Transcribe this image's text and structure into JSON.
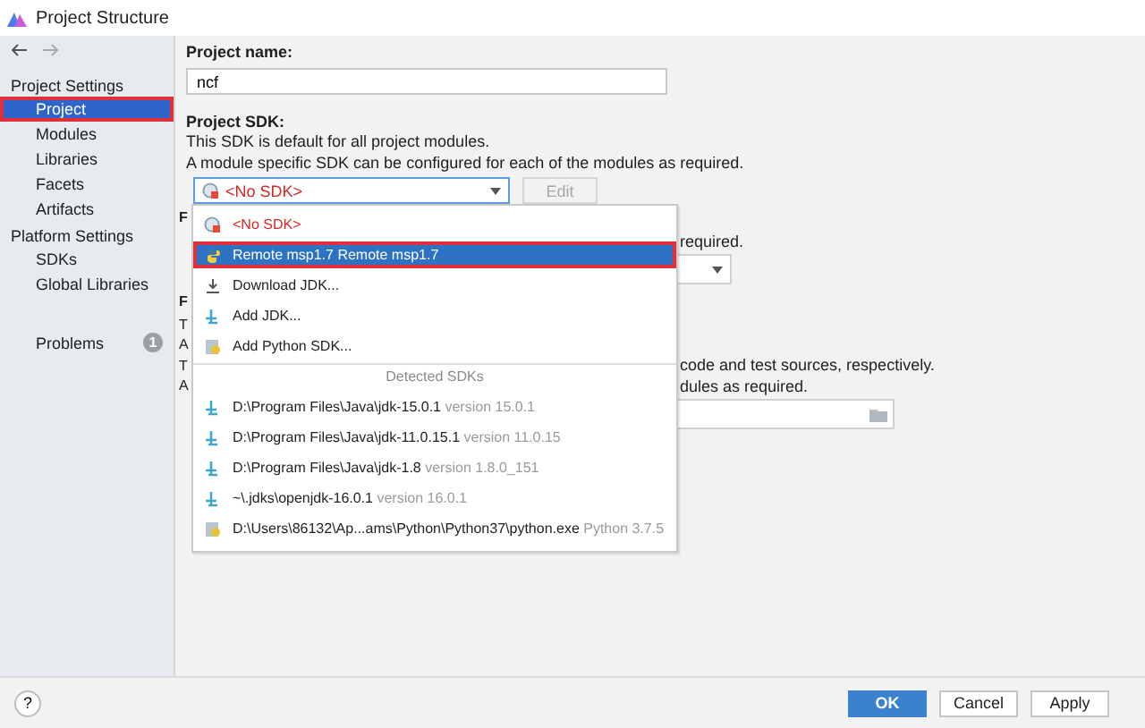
{
  "window": {
    "title": "Project Structure"
  },
  "sidebar": {
    "sections": [
      {
        "heading": "Project Settings",
        "items": [
          {
            "label": "Project",
            "selected": true,
            "outlined": true
          },
          {
            "label": "Modules",
            "selected": false,
            "outlined": false
          },
          {
            "label": "Libraries",
            "selected": false,
            "outlined": false
          },
          {
            "label": "Facets",
            "selected": false,
            "outlined": false
          },
          {
            "label": "Artifacts",
            "selected": false,
            "outlined": false
          }
        ]
      },
      {
        "heading": "Platform Settings",
        "items": [
          {
            "label": "SDKs",
            "selected": false,
            "outlined": false
          },
          {
            "label": "Global Libraries",
            "selected": false,
            "outlined": false
          }
        ]
      }
    ],
    "problems": {
      "label": "Problems",
      "count": "1"
    }
  },
  "project_name": {
    "label": "Project name:",
    "value": "ncf"
  },
  "project_sdk": {
    "label": "Project SDK:",
    "description": [
      "This SDK is default for all project modules.",
      "A module specific SDK can be configured for each of the modules as required."
    ],
    "combo": {
      "value": "<No SDK>"
    },
    "edit_button": {
      "label": "Edit",
      "disabled": true
    }
  },
  "background_rows": [
    {
      "kind": "heading",
      "left": "F"
    },
    {
      "kind": "text",
      "right": "required."
    },
    {
      "kind": "combo"
    },
    {
      "kind": "heading",
      "left": "F"
    },
    {
      "kind": "text",
      "left": "T"
    },
    {
      "kind": "text",
      "left": "A"
    },
    {
      "kind": "text",
      "left": "T",
      "right": "code and test sources, respectively."
    },
    {
      "kind": "text",
      "left": "A",
      "right": "dules as required."
    },
    {
      "kind": "field"
    }
  ],
  "sdk_popup": {
    "items": [
      {
        "kind": "no-sdk",
        "label": "<No SDK>",
        "error": true,
        "selected": false,
        "outlined": false
      },
      {
        "kind": "python",
        "label": "Remote msp1.7 Remote msp1.7",
        "error": false,
        "selected": true,
        "outlined": true
      },
      {
        "kind": "download",
        "label": "Download JDK...",
        "error": false,
        "selected": false,
        "outlined": false
      },
      {
        "kind": "jdk",
        "label": "Add JDK...",
        "error": false,
        "selected": false,
        "outlined": false
      },
      {
        "kind": "python-sdk",
        "label": "Add Python SDK...",
        "error": false,
        "selected": false,
        "outlined": false
      },
      {
        "kind": "separator",
        "label": "Detected SDKs"
      },
      {
        "kind": "jdk",
        "label": "D:\\Program Files\\Java\\jdk-15.0.1",
        "detail": "version 15.0.1",
        "error": false,
        "selected": false,
        "outlined": false
      },
      {
        "kind": "jdk",
        "label": "D:\\Program Files\\Java\\jdk-11.0.15.1",
        "detail": "version 11.0.15",
        "error": false,
        "selected": false,
        "outlined": false
      },
      {
        "kind": "jdk",
        "label": "D:\\Program Files\\Java\\jdk-1.8",
        "detail": "version 1.8.0_151",
        "error": false,
        "selected": false,
        "outlined": false
      },
      {
        "kind": "jdk",
        "label": "~\\.jdks\\openjdk-16.0.1",
        "detail": "version 16.0.1",
        "error": false,
        "selected": false,
        "outlined": false
      },
      {
        "kind": "python-sdk",
        "label": "D:\\Users\\86132\\Ap...ams\\Python\\Python37\\python.exe",
        "detail": "Python 3.7.5",
        "error": false,
        "selected": false,
        "outlined": false
      }
    ]
  },
  "help": {
    "label": "?"
  },
  "footer": {
    "buttons": [
      {
        "label": "OK",
        "primary": true
      },
      {
        "label": "Cancel",
        "primary": false
      },
      {
        "label": "Apply",
        "primary": false
      }
    ]
  }
}
